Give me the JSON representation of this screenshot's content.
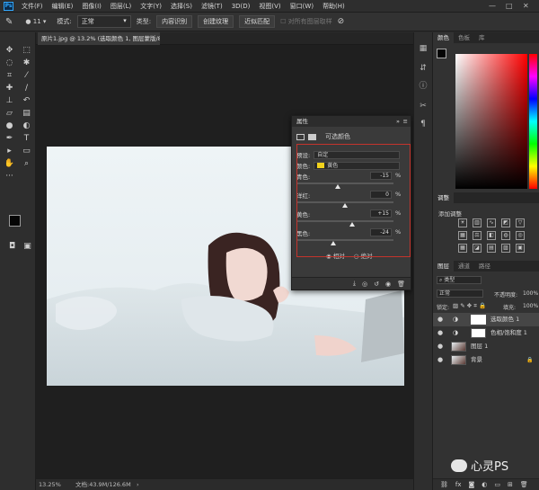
{
  "menubar": {
    "logo": "Ps",
    "items": [
      "文件(F)",
      "编辑(E)",
      "图像(I)",
      "图层(L)",
      "文字(Y)",
      "选择(S)",
      "滤镜(T)",
      "3D(D)",
      "视图(V)",
      "窗口(W)",
      "帮助(H)"
    ],
    "window_controls": [
      "—",
      "□",
      "✕"
    ]
  },
  "options": {
    "size": "11",
    "mode_label": "模式:",
    "mode_value": "正常",
    "type_label": "类型:",
    "btn_content": "内容识别",
    "btn_texture": "创建纹理",
    "btn_approx": "近似匹配",
    "sample_all": "对所有图层取样"
  },
  "document": {
    "tab": "原片1.jpg @ 13.2% (选取颜色 1, 图层蒙版/8) *",
    "status_zoom": "13.25%",
    "status_doc": "文档:43.9M/126.6M"
  },
  "properties": {
    "title": "属性",
    "subtitle": "可选颜色",
    "preset_label": "预设:",
    "preset_value": "自定",
    "color_label": "颜色:",
    "color_value": "黄色",
    "swatch": "#f2d21c",
    "sliders": [
      {
        "label": "青色:",
        "value": "-15",
        "unit": "%",
        "pos": 0.43
      },
      {
        "label": "洋红:",
        "value": "0",
        "unit": "%",
        "pos": 0.5
      },
      {
        "label": "黄色:",
        "value": "+15",
        "unit": "%",
        "pos": 0.57
      },
      {
        "label": "黑色:",
        "value": "-24",
        "unit": "%",
        "pos": 0.38
      }
    ],
    "radio_relative": "相对",
    "radio_absolute": "绝对"
  },
  "color_panel": {
    "tabs": [
      "颜色",
      "色板",
      "库"
    ],
    "hue": "#ff0000"
  },
  "adjust_panel": {
    "tab": "调整",
    "add": "添加调整"
  },
  "layers": {
    "tabs": [
      "图层",
      "通道",
      "路径"
    ],
    "filter": "类型",
    "blend": "正常",
    "opacity_label": "不透明度:",
    "opacity_value": "100%",
    "lock_label": "锁定:",
    "fill_label": "填充:",
    "fill_value": "100%",
    "items": [
      {
        "name": "选取颜色 1"
      },
      {
        "name": "色相/饱和度 1"
      },
      {
        "name": "图层 1"
      },
      {
        "name": "背景"
      }
    ]
  },
  "watermark": "心灵PS"
}
